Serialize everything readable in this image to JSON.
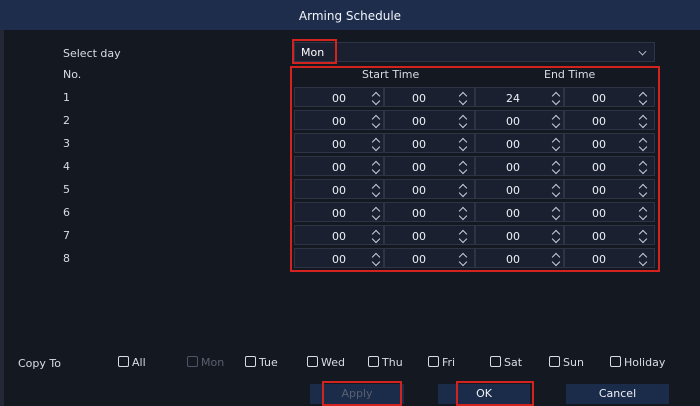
{
  "dialog": {
    "title": "Arming Schedule"
  },
  "select_day": {
    "label": "Select day",
    "value": "Mon"
  },
  "table": {
    "no_header": "No.",
    "start_header": "Start Time",
    "end_header": "End Time",
    "rows": [
      {
        "no": "1",
        "start_h": "00",
        "start_m": "00",
        "end_h": "24",
        "end_m": "00"
      },
      {
        "no": "2",
        "start_h": "00",
        "start_m": "00",
        "end_h": "00",
        "end_m": "00"
      },
      {
        "no": "3",
        "start_h": "00",
        "start_m": "00",
        "end_h": "00",
        "end_m": "00"
      },
      {
        "no": "4",
        "start_h": "00",
        "start_m": "00",
        "end_h": "00",
        "end_m": "00"
      },
      {
        "no": "5",
        "start_h": "00",
        "start_m": "00",
        "end_h": "00",
        "end_m": "00"
      },
      {
        "no": "6",
        "start_h": "00",
        "start_m": "00",
        "end_h": "00",
        "end_m": "00"
      },
      {
        "no": "7",
        "start_h": "00",
        "start_m": "00",
        "end_h": "00",
        "end_m": "00"
      },
      {
        "no": "8",
        "start_h": "00",
        "start_m": "00",
        "end_h": "00",
        "end_m": "00"
      }
    ]
  },
  "copy_to": {
    "label": "Copy To",
    "options": [
      {
        "label": "All",
        "checked": false,
        "disabled": false
      },
      {
        "label": "Mon",
        "checked": false,
        "disabled": true
      },
      {
        "label": "Tue",
        "checked": false,
        "disabled": false
      },
      {
        "label": "Wed",
        "checked": false,
        "disabled": false
      },
      {
        "label": "Thu",
        "checked": false,
        "disabled": false
      },
      {
        "label": "Fri",
        "checked": false,
        "disabled": false
      },
      {
        "label": "Sat",
        "checked": false,
        "disabled": false
      },
      {
        "label": "Sun",
        "checked": false,
        "disabled": false
      },
      {
        "label": "Holiday",
        "checked": false,
        "disabled": false
      }
    ]
  },
  "buttons": {
    "apply": "Apply",
    "ok": "OK",
    "cancel": "Cancel"
  },
  "colors": {
    "highlight": "#d3231f",
    "titlebar": "#1f2d4d",
    "background": "#141821"
  }
}
